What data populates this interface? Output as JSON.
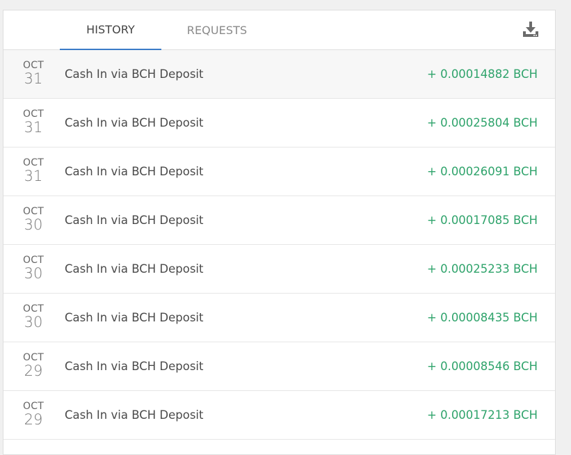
{
  "tabs": {
    "history": "HISTORY",
    "requests": "REQUESTS"
  },
  "colors": {
    "active_tab_underline": "#3a7bc8",
    "amount_positive": "#2fa36b"
  },
  "toolbar": {
    "download_icon": "download-icon"
  },
  "transactions": [
    {
      "month": "OCT",
      "day": "31",
      "description": "Cash In via BCH Deposit",
      "amount": "+ 0.00014882 BCH"
    },
    {
      "month": "OCT",
      "day": "31",
      "description": "Cash In via BCH Deposit",
      "amount": "+ 0.00025804 BCH"
    },
    {
      "month": "OCT",
      "day": "31",
      "description": "Cash In via BCH Deposit",
      "amount": "+ 0.00026091 BCH"
    },
    {
      "month": "OCT",
      "day": "30",
      "description": "Cash In via BCH Deposit",
      "amount": "+ 0.00017085 BCH"
    },
    {
      "month": "OCT",
      "day": "30",
      "description": "Cash In via BCH Deposit",
      "amount": "+ 0.00025233 BCH"
    },
    {
      "month": "OCT",
      "day": "30",
      "description": "Cash In via BCH Deposit",
      "amount": "+ 0.00008435 BCH"
    },
    {
      "month": "OCT",
      "day": "29",
      "description": "Cash In via BCH Deposit",
      "amount": "+ 0.00008546 BCH"
    },
    {
      "month": "OCT",
      "day": "29",
      "description": "Cash In via BCH Deposit",
      "amount": "+ 0.00017213 BCH"
    }
  ]
}
